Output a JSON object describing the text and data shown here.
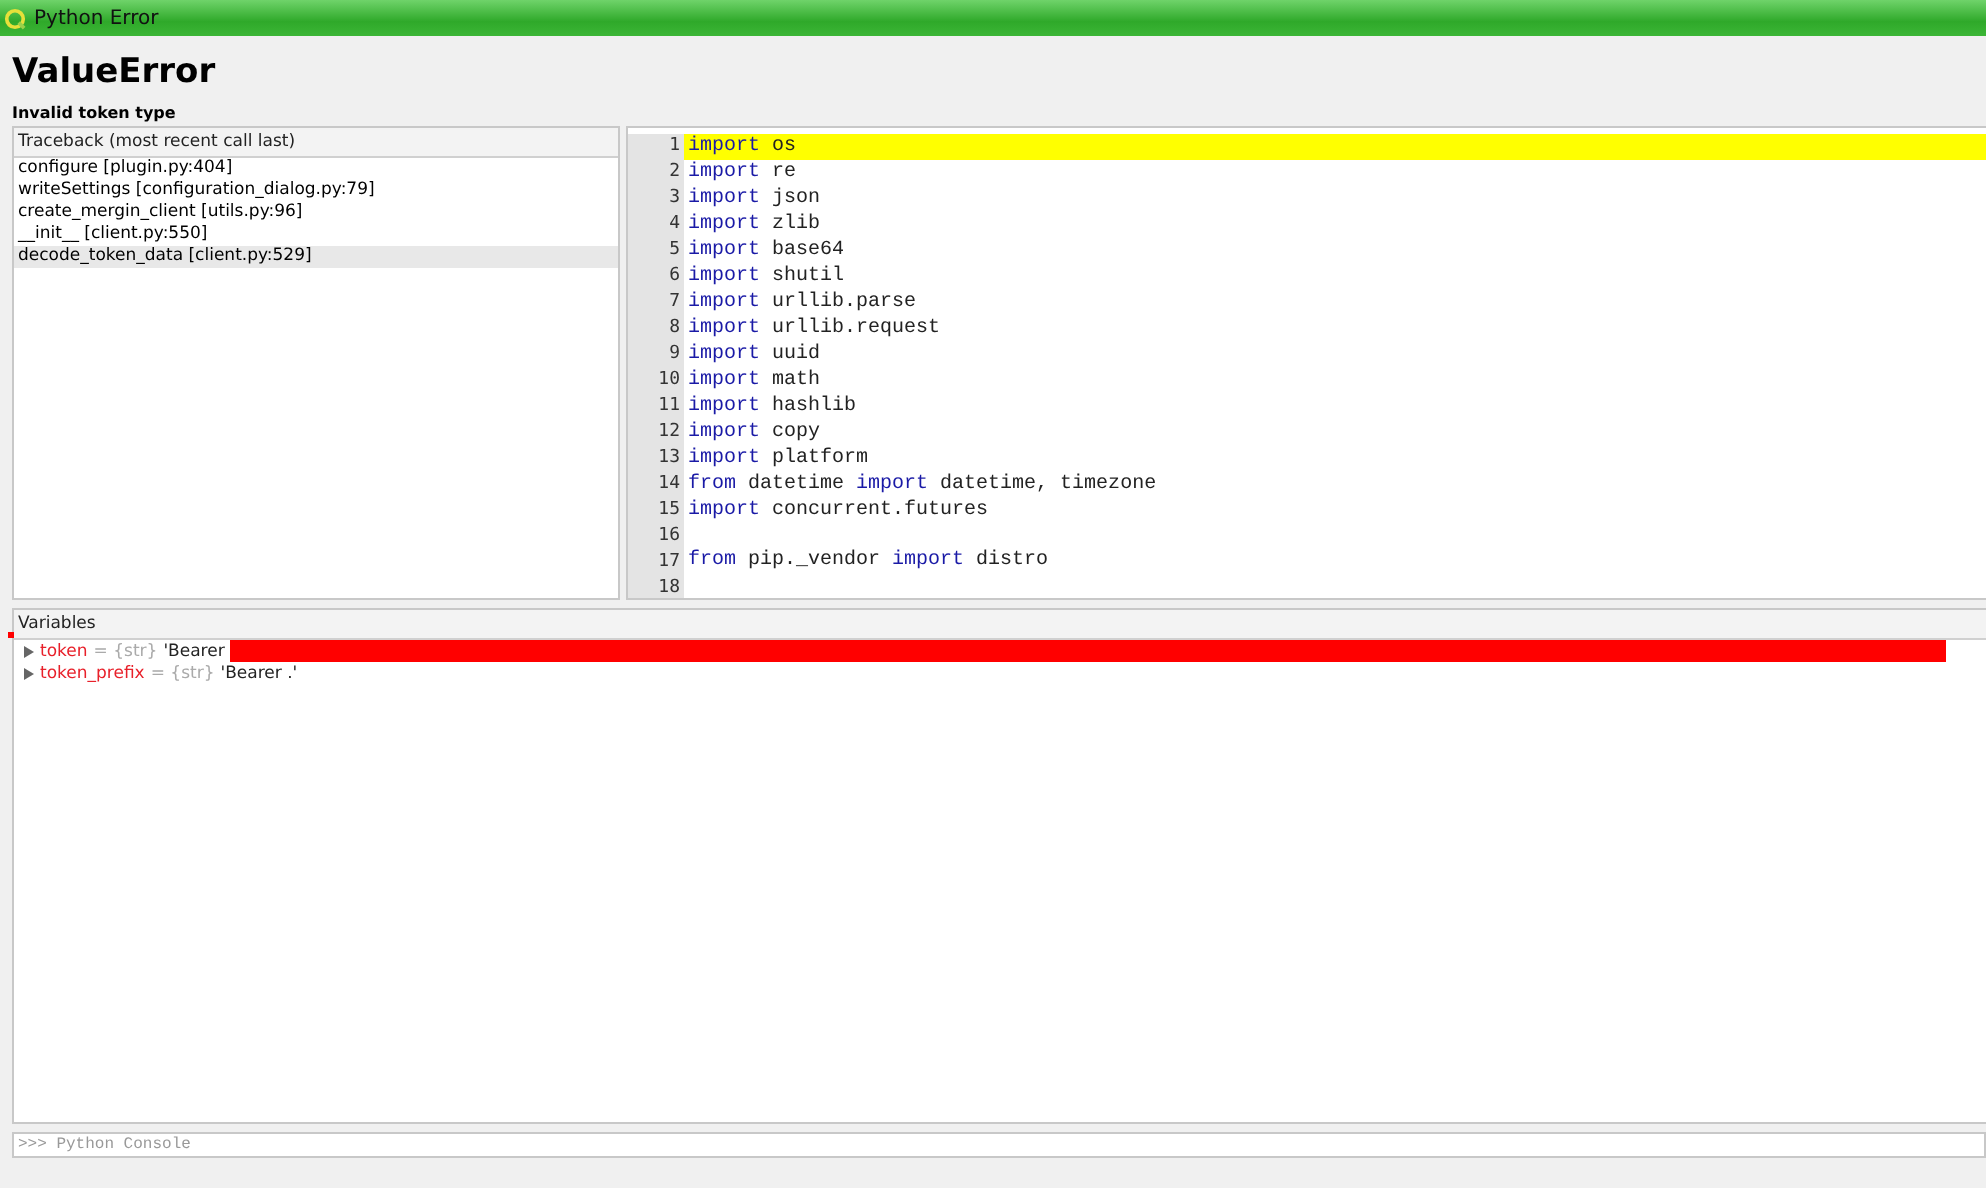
{
  "window": {
    "title": "Python Error"
  },
  "error": {
    "type": "ValueError",
    "message": "Invalid token type"
  },
  "traceback": {
    "header": "Traceback (most recent call last)",
    "frames": [
      {
        "label": "configure [plugin.py:404]",
        "selected": false
      },
      {
        "label": "writeSettings [configuration_dialog.py:79]",
        "selected": false
      },
      {
        "label": "create_mergin_client [utils.py:96]",
        "selected": false
      },
      {
        "label": "__init__ [client.py:550]",
        "selected": false
      },
      {
        "label": "decode_token_data [client.py:529]",
        "selected": true
      }
    ]
  },
  "code": {
    "lines": [
      {
        "number": "1",
        "selected": true,
        "segments": [
          {
            "kind": "keyword",
            "text": "import"
          },
          {
            "kind": "plain",
            "text": " os"
          }
        ]
      },
      {
        "number": "2",
        "selected": false,
        "segments": [
          {
            "kind": "keyword",
            "text": "import"
          },
          {
            "kind": "plain",
            "text": " re"
          }
        ]
      },
      {
        "number": "3",
        "selected": false,
        "segments": [
          {
            "kind": "keyword",
            "text": "import"
          },
          {
            "kind": "plain",
            "text": " json"
          }
        ]
      },
      {
        "number": "4",
        "selected": false,
        "segments": [
          {
            "kind": "keyword",
            "text": "import"
          },
          {
            "kind": "plain",
            "text": " zlib"
          }
        ]
      },
      {
        "number": "5",
        "selected": false,
        "segments": [
          {
            "kind": "keyword",
            "text": "import"
          },
          {
            "kind": "plain",
            "text": " base64"
          }
        ]
      },
      {
        "number": "6",
        "selected": false,
        "segments": [
          {
            "kind": "keyword",
            "text": "import"
          },
          {
            "kind": "plain",
            "text": " shutil"
          }
        ]
      },
      {
        "number": "7",
        "selected": false,
        "segments": [
          {
            "kind": "keyword",
            "text": "import"
          },
          {
            "kind": "plain",
            "text": " urllib.parse"
          }
        ]
      },
      {
        "number": "8",
        "selected": false,
        "segments": [
          {
            "kind": "keyword",
            "text": "import"
          },
          {
            "kind": "plain",
            "text": " urllib.request"
          }
        ]
      },
      {
        "number": "9",
        "selected": false,
        "segments": [
          {
            "kind": "keyword",
            "text": "import"
          },
          {
            "kind": "plain",
            "text": " uuid"
          }
        ]
      },
      {
        "number": "10",
        "selected": false,
        "segments": [
          {
            "kind": "keyword",
            "text": "import"
          },
          {
            "kind": "plain",
            "text": " math"
          }
        ]
      },
      {
        "number": "11",
        "selected": false,
        "segments": [
          {
            "kind": "keyword",
            "text": "import"
          },
          {
            "kind": "plain",
            "text": " hashlib"
          }
        ]
      },
      {
        "number": "12",
        "selected": false,
        "segments": [
          {
            "kind": "keyword",
            "text": "import"
          },
          {
            "kind": "plain",
            "text": " copy"
          }
        ]
      },
      {
        "number": "13",
        "selected": false,
        "segments": [
          {
            "kind": "keyword",
            "text": "import"
          },
          {
            "kind": "plain",
            "text": " platform"
          }
        ]
      },
      {
        "number": "14",
        "selected": false,
        "segments": [
          {
            "kind": "keyword",
            "text": "from"
          },
          {
            "kind": "plain",
            "text": " datetime "
          },
          {
            "kind": "keyword",
            "text": "import"
          },
          {
            "kind": "plain",
            "text": " datetime, timezone"
          }
        ]
      },
      {
        "number": "15",
        "selected": false,
        "segments": [
          {
            "kind": "keyword",
            "text": "import"
          },
          {
            "kind": "plain",
            "text": " concurrent.futures"
          }
        ]
      },
      {
        "number": "16",
        "selected": false
      },
      {
        "number": "17",
        "selected": false,
        "segments": [
          {
            "kind": "keyword",
            "text": "from"
          },
          {
            "kind": "plain",
            "text": " pip._vendor "
          },
          {
            "kind": "keyword",
            "text": "import"
          },
          {
            "kind": "plain",
            "text": " distro"
          }
        ]
      },
      {
        "number": "18",
        "selected": false
      }
    ]
  },
  "variables": {
    "header": "Variables",
    "items": [
      {
        "name": "token",
        "type": "= {str}",
        "value": "'Bearer",
        "redacted": true
      },
      {
        "name": "token_prefix",
        "type": "= {str}",
        "value": "'Bearer .'",
        "redacted": false
      }
    ]
  },
  "console": {
    "placeholder": ">>> Python Console"
  }
}
